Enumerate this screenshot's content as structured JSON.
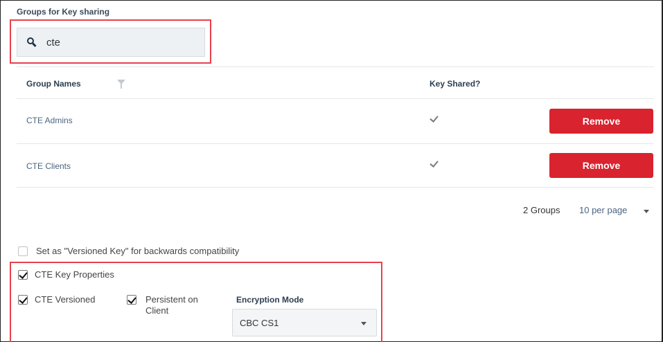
{
  "section": {
    "title": "Groups for Key sharing"
  },
  "search": {
    "value": "cte",
    "icon": "search-icon"
  },
  "table": {
    "columns": [
      "Group Names",
      "Key Shared?"
    ],
    "rows": [
      {
        "name": "CTE Admins",
        "key_shared": true,
        "action": "Remove"
      },
      {
        "name": "CTE Clients",
        "key_shared": true,
        "action": "Remove"
      }
    ]
  },
  "pager": {
    "count": "2 Groups",
    "per_page": "10 per page"
  },
  "versioned_key": {
    "label": "Set as \"Versioned Key\" for backwards compatibility",
    "checked": false
  },
  "cte_properties": {
    "label": "CTE Key Properties",
    "checked": true,
    "versioned": {
      "label": "CTE Versioned",
      "checked": true
    },
    "persistent": {
      "label_line1": "Persistent on",
      "label_line2": "Client",
      "checked": true
    },
    "encryption_mode": {
      "label": "Encryption Mode",
      "value": "CBC CS1"
    }
  },
  "colors": {
    "remove_button": "#d9232e",
    "highlight": "#e8414d"
  }
}
